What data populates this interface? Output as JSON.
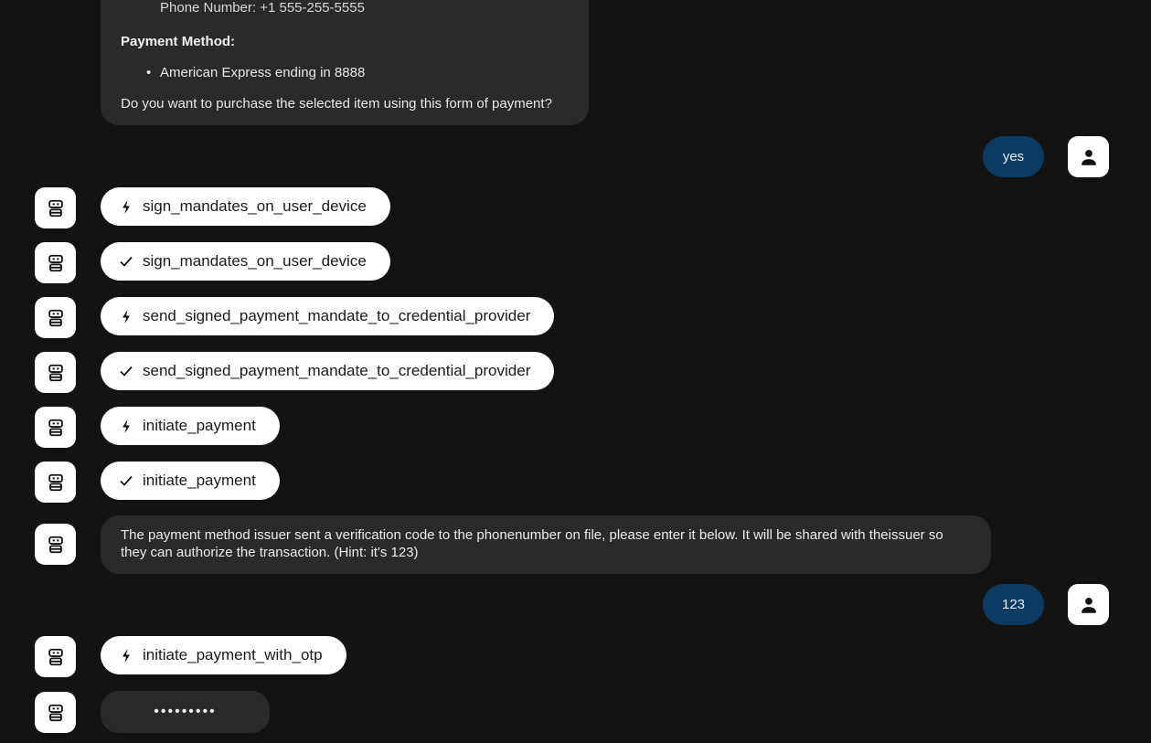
{
  "top_card": {
    "cut_text": "Phone Number: +1 555-255-5555",
    "payment_heading": "Payment Method:",
    "payment_item": "American Express ending in 8888",
    "question": "Do you want to purchase the selected item using this form of payment?"
  },
  "user_messages": [
    {
      "text": "yes"
    },
    {
      "text": "123"
    }
  ],
  "tool_calls": [
    {
      "status": "running",
      "icon": "lightning-icon",
      "label": "sign_mandates_on_user_device"
    },
    {
      "status": "done",
      "icon": "check-icon",
      "label": "sign_mandates_on_user_device"
    },
    {
      "status": "running",
      "icon": "lightning-icon",
      "label": "send_signed_payment_mandate_to_credential_provider"
    },
    {
      "status": "done",
      "icon": "check-icon",
      "label": "send_signed_payment_mandate_to_credential_provider"
    },
    {
      "status": "running",
      "icon": "lightning-icon",
      "label": "initiate_payment"
    },
    {
      "status": "done",
      "icon": "check-icon",
      "label": "initiate_payment"
    },
    {
      "status": "running",
      "icon": "lightning-icon",
      "label": "initiate_payment_with_otp"
    }
  ],
  "agent_message": {
    "text": "The payment method issuer sent a verification code to the phonenumber on file, please enter it below. It will be shared with theissuer so they can authorize the transaction. (Hint: it's 123)"
  },
  "typing_indicator": {
    "text": "•••••••••"
  },
  "icons": {
    "agent_avatar": "robot-icon",
    "user_avatar": "person-icon"
  },
  "colors": {
    "background": "#131313",
    "agent_bubble": "#2a2a2a",
    "user_bubble": "#0b3a63",
    "pill": "#ffffff"
  }
}
